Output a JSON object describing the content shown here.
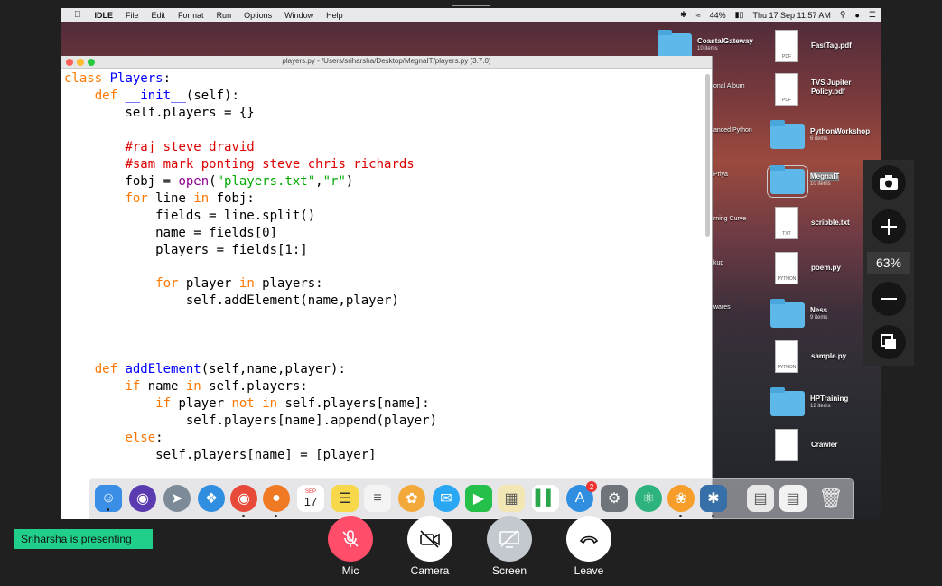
{
  "menubar": {
    "app": "IDLE",
    "items": [
      "File",
      "Edit",
      "Format",
      "Run",
      "Options",
      "Window",
      "Help"
    ],
    "battery": "44%",
    "clock": "Thu 17 Sep  11:57 AM"
  },
  "idle": {
    "title": "players.py - /Users/sriharsha/Desktop/MegnaIT/players.py (3.7.0)"
  },
  "desktop": {
    "icons": [
      {
        "name": "CoastalGateway",
        "sub": "10 items",
        "kind": "folder"
      },
      {
        "name": "FastTag.pdf",
        "sub": "",
        "kind": "file",
        "tag": "PDF"
      },
      {
        "name": "TVS Jupiter Policy.pdf",
        "sub": "",
        "kind": "file",
        "tag": "PDF"
      },
      {
        "name": "PythonWorkshop",
        "sub": "6 items",
        "kind": "folder"
      },
      {
        "name": "MegnaIT",
        "sub": "10 items",
        "kind": "folder"
      },
      {
        "name": "scribble.txt",
        "sub": "",
        "kind": "file",
        "tag": "TXT"
      },
      {
        "name": "poem.py",
        "sub": "",
        "kind": "file",
        "tag": "PYTHON"
      },
      {
        "name": "Ness",
        "sub": "9 items",
        "kind": "folder"
      },
      {
        "name": "sample.py",
        "sub": "",
        "kind": "file",
        "tag": "PYTHON"
      },
      {
        "name": "HPTraining",
        "sub": "12 items",
        "kind": "folder"
      },
      {
        "name": "Crawler",
        "sub": "",
        "kind": "file",
        "tag": ""
      }
    ],
    "partial_labels": [
      "onal Album",
      "anced Python",
      "Priya",
      "rning Curve",
      "kup",
      "wares"
    ]
  },
  "dock": {
    "calendar_month": "SEP",
    "calendar_day": "17",
    "appstore_badge": "2"
  },
  "zoom": {
    "level": "63%"
  },
  "meeting": {
    "presenting": "Sriharsha is presenting",
    "mic": "Mic",
    "camera": "Camera",
    "screen": "Screen",
    "leave": "Leave"
  },
  "colors": {
    "mic": "#ff4d6a",
    "camera": "#ffffff",
    "screen": "#c4c9cf",
    "leave": "#ffffff",
    "presenting_bg": "#1fcf8a"
  }
}
